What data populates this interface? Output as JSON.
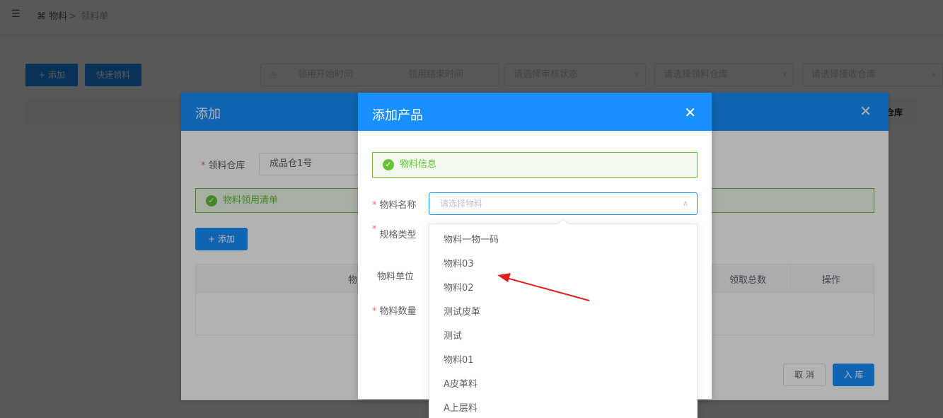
{
  "topbar": {
    "breadcrumb_root": "物料",
    "breadcrumb_sep": ">",
    "breadcrumb_current": "领料单"
  },
  "toolbar": {
    "add_label": "+ 添加",
    "quick_label": "快速领料",
    "start_time_placeholder": "领用开始时间",
    "end_time_placeholder": "领用结束时间",
    "audit_status_placeholder": "请选择审核状态",
    "pick_warehouse_placeholder": "请选择领料仓库",
    "receive_warehouse_placeholder": "请选择接收仓库"
  },
  "bg_table": {
    "partial_header": "收仓库"
  },
  "outer_dialog": {
    "title": "添加",
    "warehouse_label": "领料仓库",
    "warehouse_value": "成品仓1号",
    "list_alert": "物料领用清单",
    "add_label": "+ 添加",
    "columns": [
      "物",
      "领取总数",
      "操作"
    ],
    "cancel_label": "取 消",
    "stock_in_label": "入 库"
  },
  "inner_dialog": {
    "title": "添加产品",
    "info_alert": "物料信息",
    "name_label": "物料名称",
    "name_placeholder": "请选择物料",
    "spec_label": "规格类型",
    "unit_label": "物料单位",
    "qty_label": "物料数量"
  },
  "dropdown": {
    "options": [
      "物料一物一码",
      "物料03",
      "物料02",
      "测试皮革",
      "测试",
      "物料01",
      "A皮革料",
      "A上层料"
    ]
  },
  "colors": {
    "primary": "#1890ff",
    "success": "#67c23a",
    "danger": "#f56c6c",
    "annotation": "#e02020"
  }
}
